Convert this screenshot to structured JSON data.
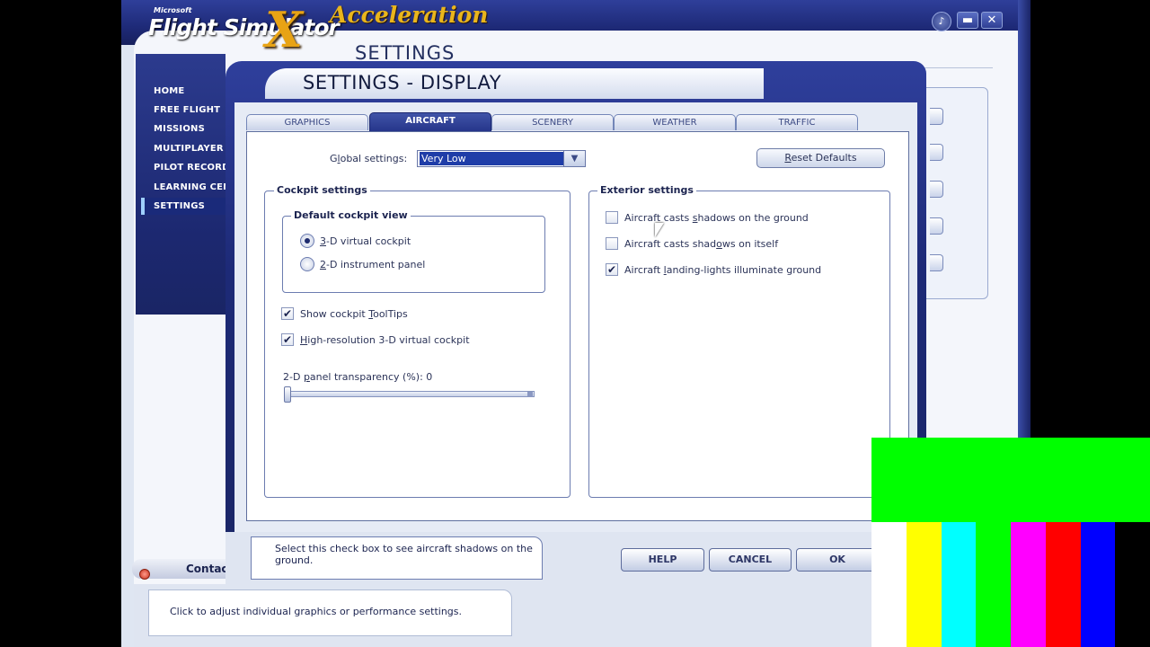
{
  "app": {
    "brand_small": "Microsoft",
    "brand_name": "Flight Simulator",
    "brand_x": "X",
    "brand_edition": "Acceleration",
    "page_title": "SETTINGS",
    "window_buttons": {
      "minimize": "▬",
      "close": "✕"
    }
  },
  "nav": {
    "items": [
      {
        "label": "HOME"
      },
      {
        "label": "FREE FLIGHT"
      },
      {
        "label": "MISSIONS"
      },
      {
        "label": "MULTIPLAYER"
      },
      {
        "label": "PILOT RECORDS"
      },
      {
        "label": "LEARNING CENT"
      },
      {
        "label": "SETTINGS",
        "selected": true
      }
    ]
  },
  "contacts": {
    "label": "Contacts"
  },
  "bottom_message": "Click to adjust individual graphics or performance settings.",
  "dialog": {
    "title": "SETTINGS - DISPLAY",
    "tabs": [
      {
        "label": "GRAPHICS"
      },
      {
        "label": "AIRCRAFT",
        "active": true
      },
      {
        "label": "SCENERY"
      },
      {
        "label": "WEATHER"
      },
      {
        "label": "TRAFFIC"
      }
    ],
    "global_settings": {
      "label_pre": "G",
      "label_u": "l",
      "label_post": "obal settings:",
      "value": "Very Low"
    },
    "reset_button": {
      "u": "R",
      "rest": "eset Defaults"
    },
    "cockpit": {
      "title": "Cockpit settings",
      "view_group": {
        "title": "Default cockpit view",
        "options": [
          {
            "u": "3",
            "rest": "-D virtual cockpit",
            "checked": true
          },
          {
            "u": "2",
            "rest": "-D instrument panel",
            "checked": false
          }
        ]
      },
      "checks": [
        {
          "label_pre": "Show cockpit ",
          "label_u": "T",
          "label_post": "oolTips",
          "checked": true
        },
        {
          "label_pre": "",
          "label_u": "H",
          "label_post": "igh-resolution 3-D virtual cockpit",
          "checked": true
        }
      ],
      "transparency": {
        "label_pre": "2-D ",
        "label_u": "p",
        "label_post": "anel transparency (%): 0",
        "value": 0
      }
    },
    "exterior": {
      "title": "Exterior settings",
      "checks": [
        {
          "label_pre": "Aircraft casts ",
          "label_u": "s",
          "label_post": "hadows on the ground",
          "checked": false
        },
        {
          "label_pre": "Aircraft casts shad",
          "label_u": "o",
          "label_post": "ws on itself",
          "checked": false
        },
        {
          "label_pre": "Aircraft ",
          "label_u": "l",
          "label_post": "anding-lights illuminate ground",
          "checked": true
        }
      ]
    },
    "help_text": "Select this check box to see aircraft shadows on the ground.",
    "buttons": {
      "help": "HELP",
      "cancel": "CANCEL",
      "ok": "OK"
    }
  },
  "test_pattern": {
    "top_color": "#00ff00",
    "bars": [
      "#ffffff",
      "#ffff00",
      "#00ffff",
      "#00ff00",
      "#ff00ff",
      "#ff0000",
      "#0000ff",
      "#000000"
    ]
  }
}
